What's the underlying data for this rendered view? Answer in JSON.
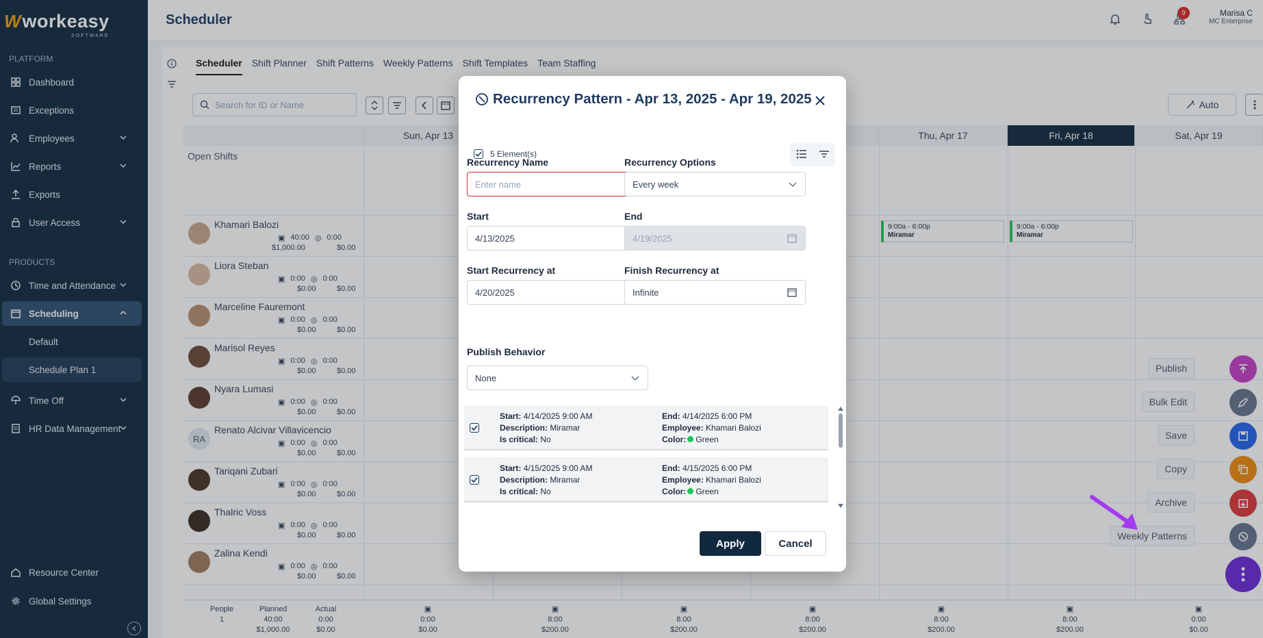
{
  "app": {
    "logo_word": "workeasy",
    "logo_sub": "SOFTWARE"
  },
  "sidebar": {
    "platform_label": "PLATFORM",
    "products_label": "PRODUCTS",
    "items": [
      {
        "label": "Dashboard"
      },
      {
        "label": "Exceptions"
      },
      {
        "label": "Employees"
      },
      {
        "label": "Reports"
      },
      {
        "label": "Exports"
      },
      {
        "label": "User Access"
      },
      {
        "label": "Time and Attendance"
      },
      {
        "label": "Scheduling"
      },
      {
        "label": "Default"
      },
      {
        "label": "Schedule Plan 1"
      },
      {
        "label": "Time Off"
      },
      {
        "label": "HR Data Management"
      },
      {
        "label": "Resource Center"
      },
      {
        "label": "Global Settings"
      }
    ]
  },
  "header": {
    "title": "Scheduler",
    "badge": "9",
    "user_name": "Marisa C",
    "user_company": "MC Enterprise"
  },
  "tabs": [
    "Scheduler",
    "Shift Planner",
    "Shift Patterns",
    "Weekly Patterns",
    "Shift Templates",
    "Team Staffing"
  ],
  "search": {
    "placeholder": "Search for ID or Name"
  },
  "auto_label": "Auto",
  "days": [
    "Sun, Apr 13",
    "Thu, Apr 17",
    "Fri, Apr 18",
    "Sat, Apr 19"
  ],
  "open_shifts": "Open Shifts",
  "employees": [
    {
      "name": "Khamari Balozi",
      "planned": "40:00",
      "actual": "0:00",
      "cost": "$1,000.00",
      "cost2": "$0.00"
    },
    {
      "name": "Liora Steban",
      "planned": "0:00",
      "actual": "0:00",
      "cost": "$0.00",
      "cost2": "$0.00"
    },
    {
      "name": "Marceline Fauremont",
      "planned": "0:00",
      "actual": "0:00",
      "cost": "$0.00",
      "cost2": "$0.00"
    },
    {
      "name": "Marisol Reyes",
      "planned": "0:00",
      "actual": "0:00",
      "cost": "$0.00",
      "cost2": "$0.00"
    },
    {
      "name": "Nyara Lumasi",
      "planned": "0:00",
      "actual": "0:00",
      "cost": "$0.00",
      "cost2": "$0.00"
    },
    {
      "name": "Renato Alcivar Villavicencio",
      "initials": "RA",
      "planned": "0:00",
      "actual": "0:00",
      "cost": "$0.00",
      "cost2": "$0.00"
    },
    {
      "name": "Tariqani Zubari",
      "planned": "0:00",
      "actual": "0:00",
      "cost": "$0.00",
      "cost2": "$0.00"
    },
    {
      "name": "Thalric Voss",
      "planned": "0:00",
      "actual": "0:00",
      "cost": "$0.00",
      "cost2": "$0.00"
    },
    {
      "name": "Zalina Kendi",
      "planned": "0:00",
      "actual": "0:00",
      "cost": "$0.00",
      "cost2": "$0.00"
    }
  ],
  "shifts": [
    {
      "time": "9:00a - 6:00p",
      "loc": "Miramar"
    },
    {
      "time": "9:00a - 6:00p",
      "loc": "Miramar"
    }
  ],
  "summary": {
    "people_label": "People",
    "people": "1",
    "planned_label": "Planned",
    "planned": "40:00",
    "planned_cost": "$1,000.00",
    "actual_label": "Actual",
    "actual": "0:00",
    "actual_cost": "$0.00",
    "days": [
      {
        "h": "0:00",
        "c": "$0.00"
      },
      {
        "h": "8:00",
        "c": "$200.00"
      },
      {
        "h": "8:00",
        "c": "$200.00"
      },
      {
        "h": "8:00",
        "c": "$200.00"
      },
      {
        "h": "8:00",
        "c": "$200.00"
      },
      {
        "h": "8:00",
        "c": "$200.00"
      },
      {
        "h": "0:00",
        "c": "$0.00"
      }
    ]
  },
  "fab": {
    "publish": "Publish",
    "bulk_edit": "Bulk Edit",
    "save": "Save",
    "copy": "Copy",
    "archive": "Archive",
    "weekly_patterns": "Weekly Patterns"
  },
  "fab_colors": {
    "publish": "#c83cc7",
    "bulk": "#64748b",
    "save": "#2563eb",
    "copy": "#f08a0c",
    "archive": "#e0363a",
    "weekly": "#64748b",
    "menu": "#6d28d9"
  },
  "modal": {
    "title": "Recurrency Pattern - Apr 13, 2025 - Apr 19, 2025",
    "count": "5 Element(s)",
    "name_label": "Recurrency Name",
    "name_placeholder": "Enter name",
    "options_label": "Recurrency Options",
    "options_value": "Every week",
    "start_label": "Start",
    "start_value": "4/13/2025",
    "end_label": "End",
    "end_value": "4/19/2025",
    "start_rec_label": "Start Recurrency at",
    "start_rec_value": "4/20/2025",
    "finish_rec_label": "Finish Recurrency at",
    "finish_rec_value": "Infinite",
    "publish_label": "Publish Behavior",
    "publish_value": "None",
    "items": [
      {
        "start": "4/14/2025 9:00 AM",
        "desc": "Miramar",
        "critical": "No",
        "end": "4/14/2025 6:00 PM",
        "employee": "Khamari Balozi",
        "color": "Green"
      },
      {
        "start": "4/15/2025 9:00 AM",
        "desc": "Miramar",
        "critical": "No",
        "end": "4/15/2025 6:00 PM",
        "employee": "Khamari Balozi",
        "color": "Green"
      }
    ],
    "k_start": "Start:",
    "k_desc": "Description:",
    "k_crit": "Is critical:",
    "k_end": "End:",
    "k_emp": "Employee:",
    "k_color": "Color:",
    "apply": "Apply",
    "cancel": "Cancel"
  }
}
